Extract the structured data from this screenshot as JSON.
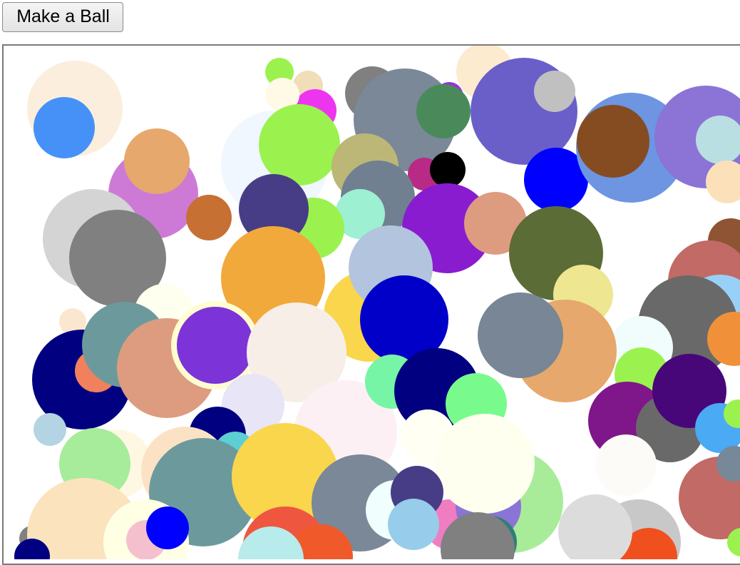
{
  "toolbar": {
    "make_ball_label": "Make a Ball"
  },
  "canvas": {
    "name": "ball-canvas"
  }
}
